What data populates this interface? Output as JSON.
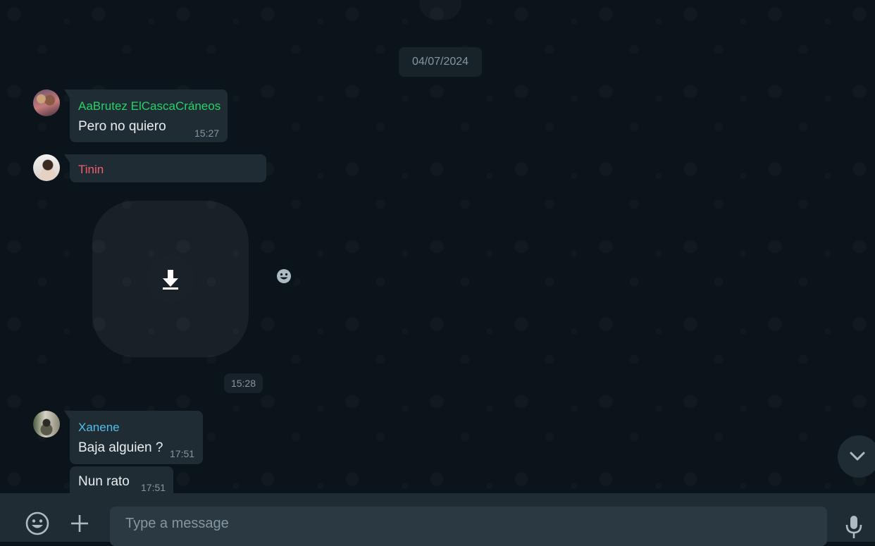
{
  "chat": {
    "date_separator": "04/07/2024",
    "messages": [
      {
        "sender": "AaBrutez ElCascaCráneos",
        "sender_color": "#25d366",
        "text": "Pero no quiero",
        "time": "15:27"
      },
      {
        "sender": "Tinin",
        "sender_color": "#f15c6d",
        "sticker_time": "15:28"
      },
      {
        "sender": "Xanene",
        "sender_color": "#53bdeb",
        "text": "Baja alguien ?",
        "time": "17:51"
      },
      {
        "text": "Nun rato",
        "time": "17:51"
      }
    ]
  },
  "composer": {
    "placeholder": "Type a message"
  },
  "icons": {
    "emoji": "emoji-icon",
    "attach": "plus-icon",
    "mic": "mic-icon",
    "download": "download-icon",
    "react": "smiley-icon",
    "scroll": "chevron-down-icon"
  },
  "colors": {
    "background": "#0b141a",
    "bubble": "#202c33",
    "composer": "#202c33",
    "input": "#2a3942",
    "meta_text": "#8696a0"
  }
}
